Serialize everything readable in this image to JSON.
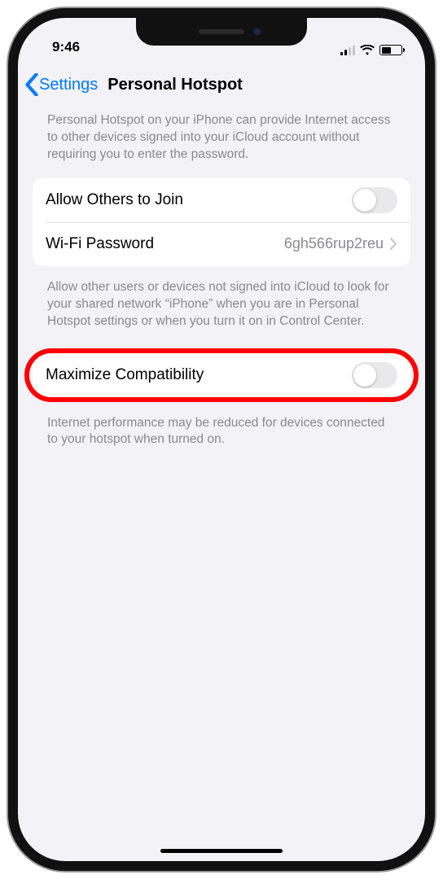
{
  "status": {
    "time": "9:46"
  },
  "nav": {
    "back_label": "Settings",
    "title": "Personal Hotspot"
  },
  "intro_text": "Personal Hotspot on your iPhone can provide Internet access to other devices signed into your iCloud account without requiring you to enter the password.",
  "group1": {
    "allow_label": "Allow Others to Join",
    "wifi_label": "Wi-Fi Password",
    "wifi_value": "6gh566rup2reu"
  },
  "group1_footer": "Allow other users or devices not signed into iCloud to look for your shared network “iPhone” when you are in Personal Hotspot settings or when you turn it on in Control Center.",
  "group2": {
    "max_label": "Maximize Compatibility"
  },
  "group2_footer": "Internet performance may be reduced for devices connected to your hotspot when turned on."
}
